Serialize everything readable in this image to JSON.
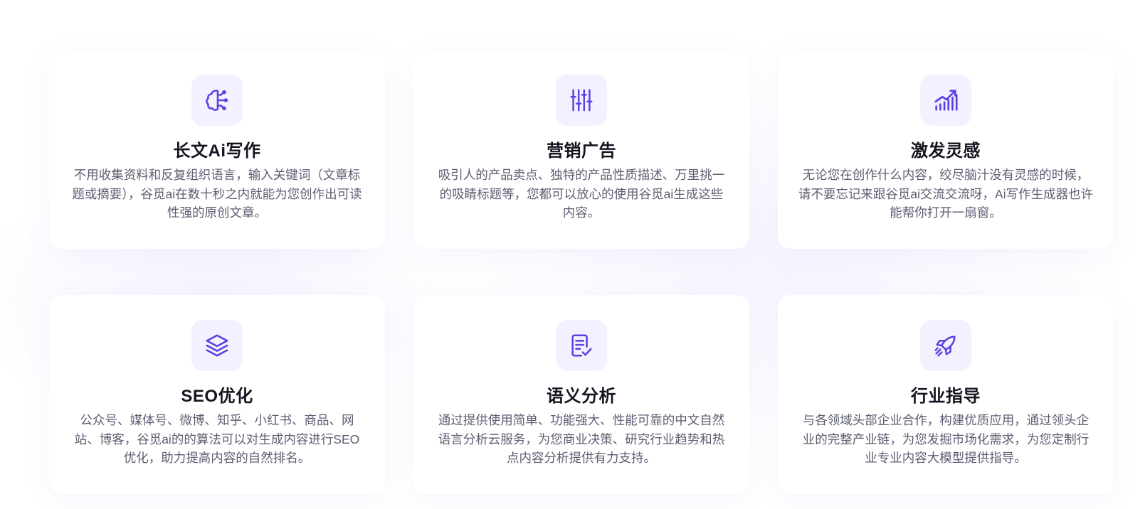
{
  "features": [
    {
      "icon": "brain-icon",
      "title": "长文Ai写作",
      "description": "不用收集资料和反复组织语言，输入关键词（文章标题或摘要），谷觅ai在数十秒之内就能为您创作出可读性强的原创文章。"
    },
    {
      "icon": "sliders-icon",
      "title": "营销广告",
      "description": "吸引人的产品卖点、独特的产品性质描述、万里挑一的吸睛标题等，您都可以放心的使用谷觅ai生成这些内容。"
    },
    {
      "icon": "growth-chart-icon",
      "title": "激发灵感",
      "description": "无论您在创作什么内容，绞尽脑汁没有灵感的时候，请不要忘记来跟谷觅ai交流交流呀，Ai写作生成器也许能帮你打开一扇窗。"
    },
    {
      "icon": "layers-icon",
      "title": "SEO优化",
      "description": "公众号、媒体号、微博、知乎、小红书、商品、网站、博客，谷觅ai的的算法可以对生成内容进行SEO优化，助力提高内容的自然排名。"
    },
    {
      "icon": "document-check-icon",
      "title": "语义分析",
      "description": "通过提供使用简单、功能强大、性能可靠的中文自然语言分析云服务，为您商业决策、研究行业趋势和热点内容分析提供有力支持。"
    },
    {
      "icon": "rocket-icon",
      "title": "行业指导",
      "description": "与各领域头部企业合作，构建优质应用，通过领头企业的完整产业链，为您发掘市场化需求，为您定制行业专业内容大模型提供指导。"
    }
  ],
  "colors": {
    "accent": "#5b3fe0",
    "icon_bg": "#f3f1ff",
    "title": "#15131f",
    "text": "#5c5e72"
  }
}
